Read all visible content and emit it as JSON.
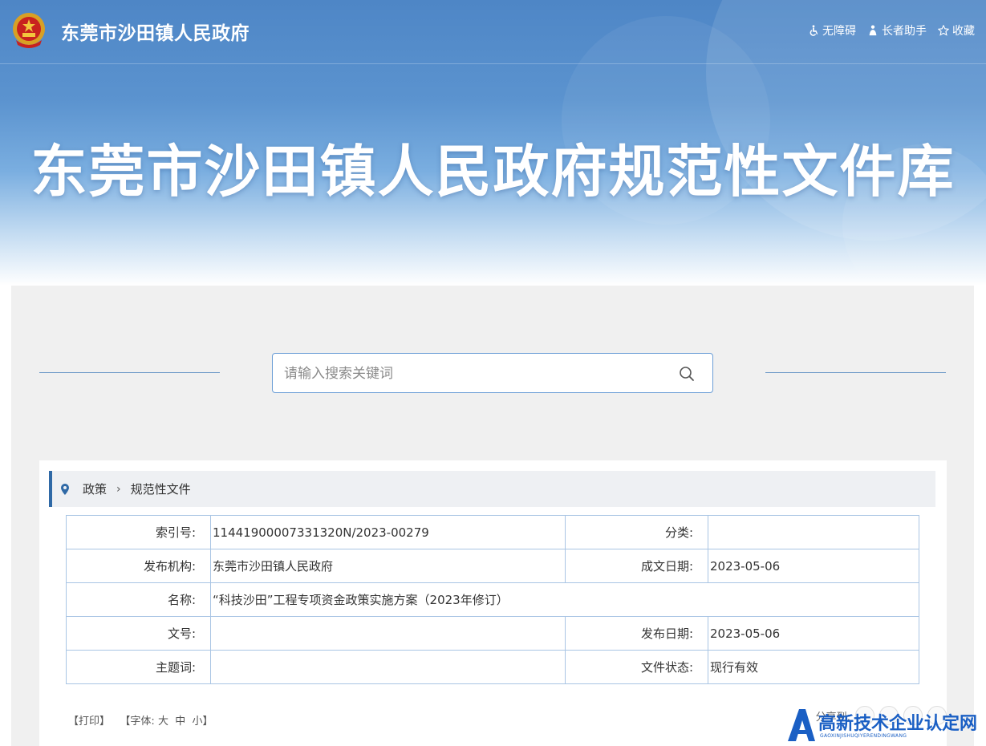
{
  "site": {
    "name": "东莞市沙田镇人民政府",
    "banner_title": "东莞市沙田镇人民政府规范性文件库"
  },
  "toolbar": {
    "accessibility": "无障碍",
    "elder_helper": "长者助手",
    "favorite": "收藏"
  },
  "search": {
    "placeholder": "请输入搜索关键词"
  },
  "breadcrumb": {
    "level1": "政策",
    "separator": "›",
    "level2": "规范性文件"
  },
  "meta": {
    "index_label": "索引号:",
    "index_value": "11441900007331320N/2023-00279",
    "category_label": "分类:",
    "category_value": "",
    "publisher_label": "发布机构:",
    "publisher_value": "东莞市沙田镇人民政府",
    "written_date_label": "成文日期:",
    "written_date_value": "2023-05-06",
    "name_label": "名称:",
    "name_value": "“科技沙田”工程专项资金政策实施方案（2023年修订）",
    "doc_no_label": "文号:",
    "doc_no_value": "",
    "publish_date_label": "发布日期:",
    "publish_date_value": "2023-05-06",
    "keywords_label": "主题词:",
    "keywords_value": "",
    "status_label": "文件状态:",
    "status_value": "现行有效"
  },
  "bottom": {
    "print": "【打印】",
    "font_prefix": "【字体:",
    "font_large": "大",
    "font_medium": "中",
    "font_small": "小",
    "font_suffix": "】",
    "share_label": "分享到:"
  },
  "watermark": {
    "title": "高新技术企业认定网",
    "subtitle": "GAOXINJISHUQIYERENDINGWANG"
  },
  "colors": {
    "banner_blue": "#4e86c6",
    "accent_blue": "#2f69a6",
    "table_border": "#a9c5e4",
    "panel_grey": "#f0f0f0"
  }
}
